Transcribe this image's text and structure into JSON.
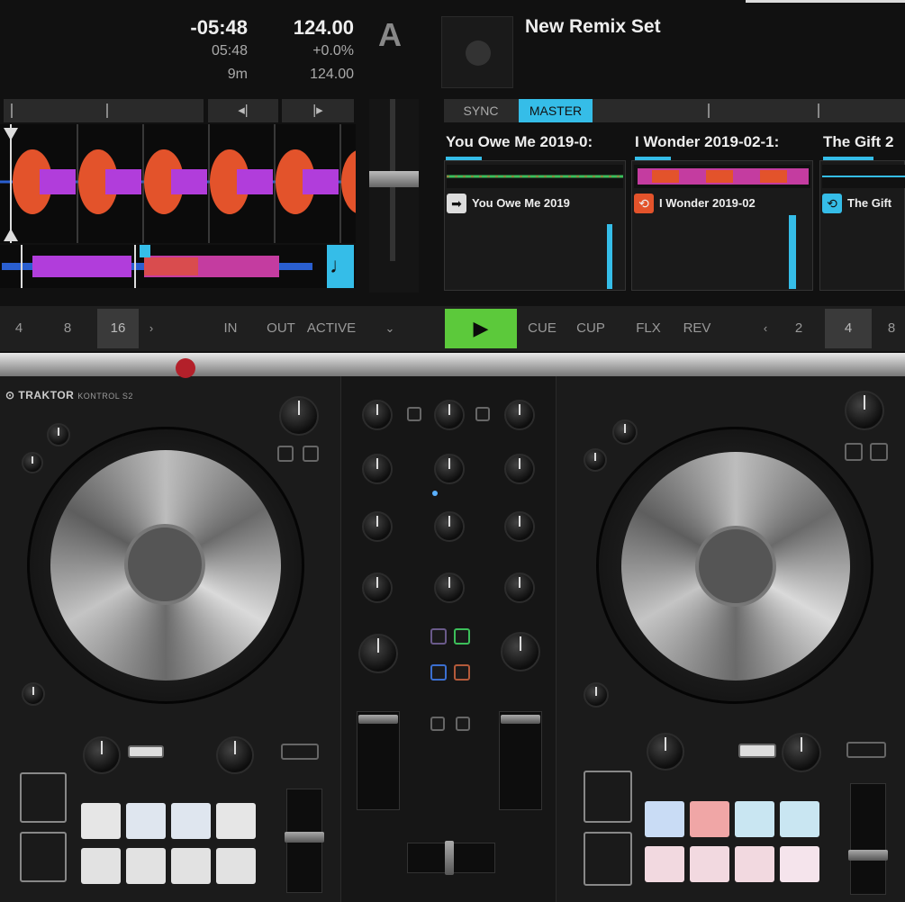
{
  "deck_a": {
    "time_remaining": "-05:48",
    "time_elapsed": "05:48",
    "duration": "9m",
    "bpm": "124.00",
    "pitch": "+0.0%",
    "base_bpm": "124.00",
    "deck_letter": "A"
  },
  "remix_deck": {
    "title": "New Remix Set",
    "sync_label": "SYNC",
    "master_label": "MASTER",
    "slots": [
      {
        "title": "You Owe Me 2019-0:",
        "sample": "You Owe Me 2019",
        "icon": "arrow-right-icon",
        "icon_char": "➡"
      },
      {
        "title": "I Wonder 2019-02-1:",
        "sample": "I Wonder 2019-02",
        "icon": "loop-icon",
        "icon_char": "⟲"
      },
      {
        "title": "The Gift 2",
        "sample": "The Gift",
        "icon": "loop-icon",
        "icon_char": "⟲"
      }
    ]
  },
  "toolbar": {
    "loop_sizes": [
      "4",
      "8",
      "16"
    ],
    "in_label": "IN",
    "out_label": "OUT",
    "active_label": "ACTIVE",
    "cue_label": "CUE",
    "cup_label": "CUP",
    "flx_label": "FLX",
    "rev_label": "REV",
    "page_numbers": [
      "2",
      "4",
      "8"
    ]
  },
  "controller": {
    "brand": "⊙ TRAKTOR",
    "model": "KONTROL S2"
  },
  "colors": {
    "accent_blue": "#35bde8",
    "play_green": "#5cc93b",
    "waveform_orange": "#e3532b",
    "waveform_purple": "#b13ddb"
  }
}
